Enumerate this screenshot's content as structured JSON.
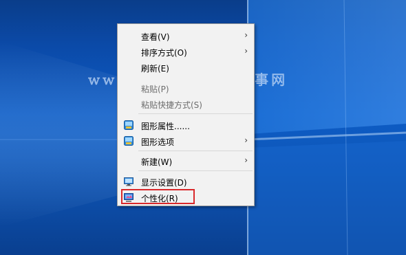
{
  "watermark": "www.pc841.com百事网",
  "context_menu": {
    "items": [
      {
        "label": "查看(V)",
        "submenu": true
      },
      {
        "label": "排序方式(O)",
        "submenu": true
      },
      {
        "label": "刷新(E)"
      },
      {
        "label": "粘贴(P)",
        "disabled": true
      },
      {
        "label": "粘贴快捷方式(S)",
        "disabled": true
      },
      {
        "label": "图形属性......",
        "icon": "intel-graphics-icon"
      },
      {
        "label": "图形选项",
        "icon": "intel-graphics-icon",
        "submenu": true
      },
      {
        "label": "新建(W)",
        "submenu": true
      },
      {
        "label": "显示设置(D)",
        "icon": "display-settings-icon"
      },
      {
        "label": "个性化(R)",
        "icon": "personalize-icon",
        "highlighted": true
      }
    ],
    "submenu_arrow": "›"
  },
  "colors": {
    "menu_bg": "#f2f2f2",
    "highlight_border": "#d9282a",
    "desktop_blue": "#0d5cc5"
  }
}
